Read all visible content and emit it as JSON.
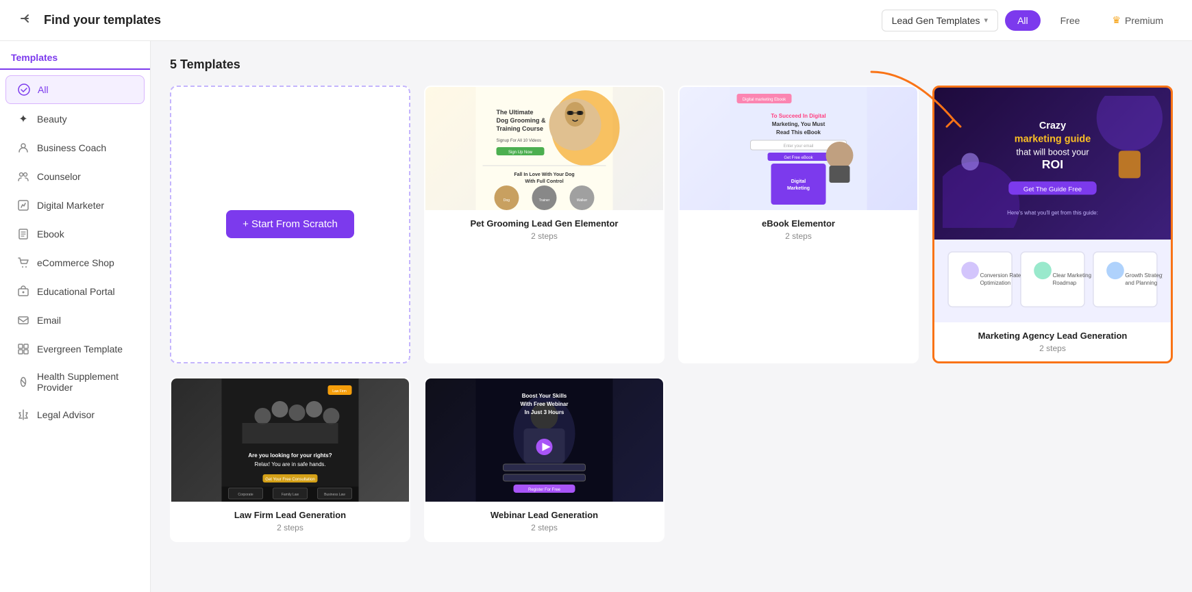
{
  "header": {
    "back_label": "←",
    "title": "Find your templates",
    "dropdown_label": "Lead Gen Templates",
    "filters": [
      {
        "id": "all",
        "label": "All",
        "active": true
      },
      {
        "id": "free",
        "label": "Free",
        "active": false
      },
      {
        "id": "premium",
        "label": "Premium",
        "active": false
      }
    ]
  },
  "sidebar": {
    "section_title": "Templates",
    "items": [
      {
        "id": "all",
        "label": "All",
        "icon": "✓",
        "active": true
      },
      {
        "id": "beauty",
        "label": "Beauty",
        "icon": "✦",
        "active": false
      },
      {
        "id": "business-coach",
        "label": "Business Coach",
        "icon": "◎",
        "active": false
      },
      {
        "id": "counselor",
        "label": "Counselor",
        "icon": "👥",
        "active": false
      },
      {
        "id": "digital-marketer",
        "label": "Digital Marketer",
        "icon": "🎯",
        "active": false
      },
      {
        "id": "ebook",
        "label": "Ebook",
        "icon": "📗",
        "active": false
      },
      {
        "id": "ecommerce-shop",
        "label": "eCommerce Shop",
        "icon": "🛒",
        "active": false
      },
      {
        "id": "educational-portal",
        "label": "Educational Portal",
        "icon": "🎓",
        "active": false
      },
      {
        "id": "email",
        "label": "Email",
        "icon": "✉",
        "active": false
      },
      {
        "id": "evergreen-template",
        "label": "Evergreen Template",
        "icon": "⊞",
        "active": false
      },
      {
        "id": "health-supplement",
        "label": "Health Supplement Provider",
        "icon": "💊",
        "active": false
      },
      {
        "id": "legal-advisor",
        "label": "Legal Advisor",
        "icon": "⚖",
        "active": false
      }
    ]
  },
  "main": {
    "count_label": "5 Templates",
    "start_from_scratch_label": "+ Start From Scratch",
    "templates": [
      {
        "id": "pet-grooming",
        "title": "Pet Grooming Lead Gen Elementor",
        "steps": "2 steps",
        "image_type": "pet",
        "highlighted": false
      },
      {
        "id": "ebook",
        "title": "eBook Elementor",
        "steps": "2 steps",
        "image_type": "ebook",
        "highlighted": false
      },
      {
        "id": "marketing-agency",
        "title": "Marketing Agency Lead Generation",
        "steps": "2 steps",
        "image_type": "marketing",
        "highlighted": true
      },
      {
        "id": "law-firm",
        "title": "Law Firm Lead Generation",
        "steps": "2 steps",
        "image_type": "law",
        "highlighted": false
      },
      {
        "id": "webinar",
        "title": "Webinar Lead Generation",
        "steps": "2 steps",
        "image_type": "webinar",
        "highlighted": false
      }
    ]
  }
}
